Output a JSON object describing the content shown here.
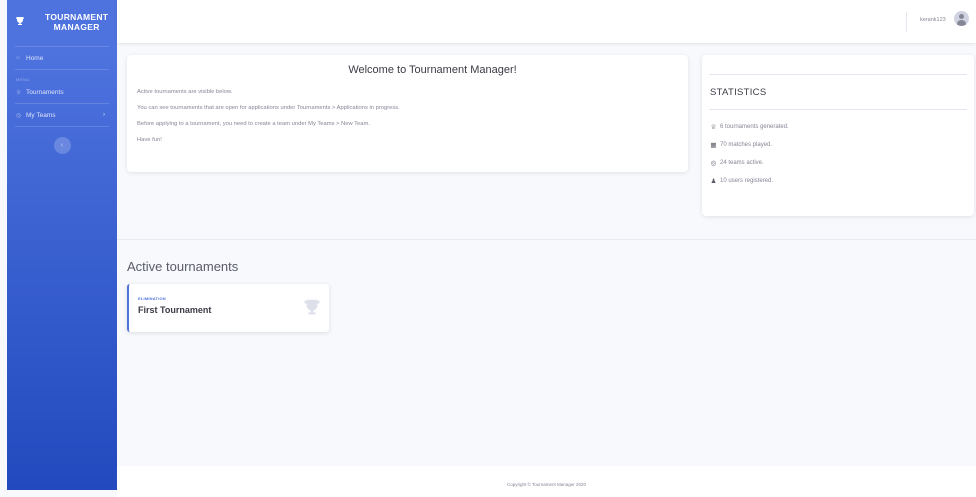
{
  "sidebar": {
    "brand_line1": "TOURNAMENT",
    "brand_line2": "MANAGER",
    "brand_icon": "trophy-icon",
    "home_label": "Home",
    "menu_heading": "MENU",
    "tournaments_label": "Tournaments",
    "myteams_label": "My Teams",
    "toggle_glyph": "‹"
  },
  "topbar": {
    "username": "kerank123"
  },
  "welcome": {
    "title": "Welcome to Tournament Manager!",
    "lines": [
      "Active tournaments are visible below.",
      "You can see tournaments that are open for applications under Tournaments > Applications in progress.",
      "Before applying to a tournament, you need to create a team under My Teams > New Team.",
      "Have fun!"
    ]
  },
  "statistics": {
    "title": "STATISTICS",
    "items": [
      "6 tournaments generated.",
      "70 matches played.",
      "24 teams active.",
      "10 users registered."
    ]
  },
  "active": {
    "title": "Active tournaments",
    "tournament": {
      "type": "ELIMINATION",
      "name": "First Tournament"
    }
  },
  "footer": {
    "text": "Copyright © Tournament Manager 2020"
  },
  "colors": {
    "primary": "#4e73df",
    "sidebar_bottom": "#224abe",
    "background": "#f8f9fc"
  }
}
